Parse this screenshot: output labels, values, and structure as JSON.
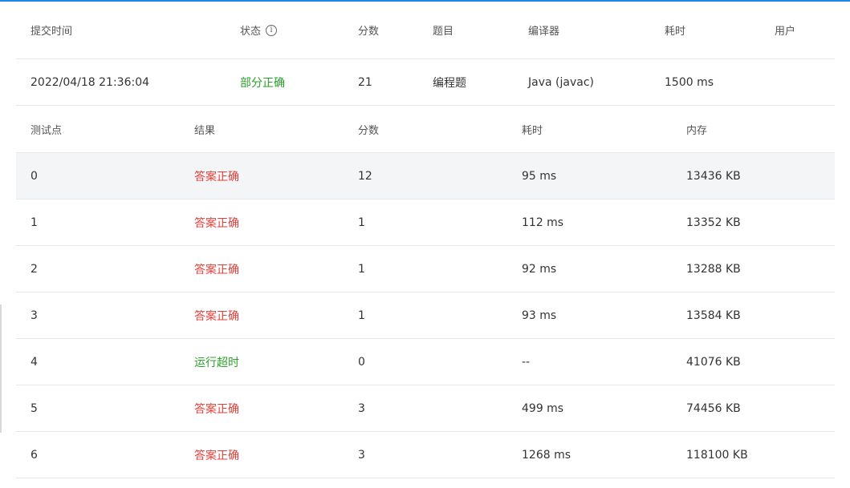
{
  "submission_header": {
    "submit_time": "提交时间",
    "status": "状态",
    "score": "分数",
    "problem": "题目",
    "compiler": "编译器",
    "time": "耗时",
    "user": "用户"
  },
  "submission": {
    "submit_time": "2022/04/18 21:36:04",
    "status": "部分正确",
    "score": "21",
    "problem": "编程题",
    "compiler": "Java (javac)",
    "time": "1500 ms",
    "user": ""
  },
  "tests_header": {
    "test_point": "测试点",
    "result": "结果",
    "score": "分数",
    "time": "耗时",
    "memory": "内存"
  },
  "tests": [
    {
      "id": "0",
      "result": "答案正确",
      "score": "12",
      "time": "95 ms",
      "memory": "13436 KB"
    },
    {
      "id": "1",
      "result": "答案正确",
      "score": "1",
      "time": "112 ms",
      "memory": "13352 KB"
    },
    {
      "id": "2",
      "result": "答案正确",
      "score": "1",
      "time": "92 ms",
      "memory": "13288 KB"
    },
    {
      "id": "3",
      "result": "答案正确",
      "score": "1",
      "time": "93 ms",
      "memory": "13584 KB"
    },
    {
      "id": "4",
      "result": "运行超时",
      "score": "0",
      "time": "--",
      "memory": "41076 KB"
    },
    {
      "id": "5",
      "result": "答案正确",
      "score": "3",
      "time": "499 ms",
      "memory": "74456 KB"
    },
    {
      "id": "6",
      "result": "答案正确",
      "score": "3",
      "time": "1268 ms",
      "memory": "118100 KB"
    }
  ],
  "colors": {
    "accepted": "#e0403a",
    "partial": "#2aa12a",
    "timeout": "#2aa12a",
    "top_bar": "#1e88e5"
  },
  "icons": {
    "status_info": "info-circle-icon"
  }
}
